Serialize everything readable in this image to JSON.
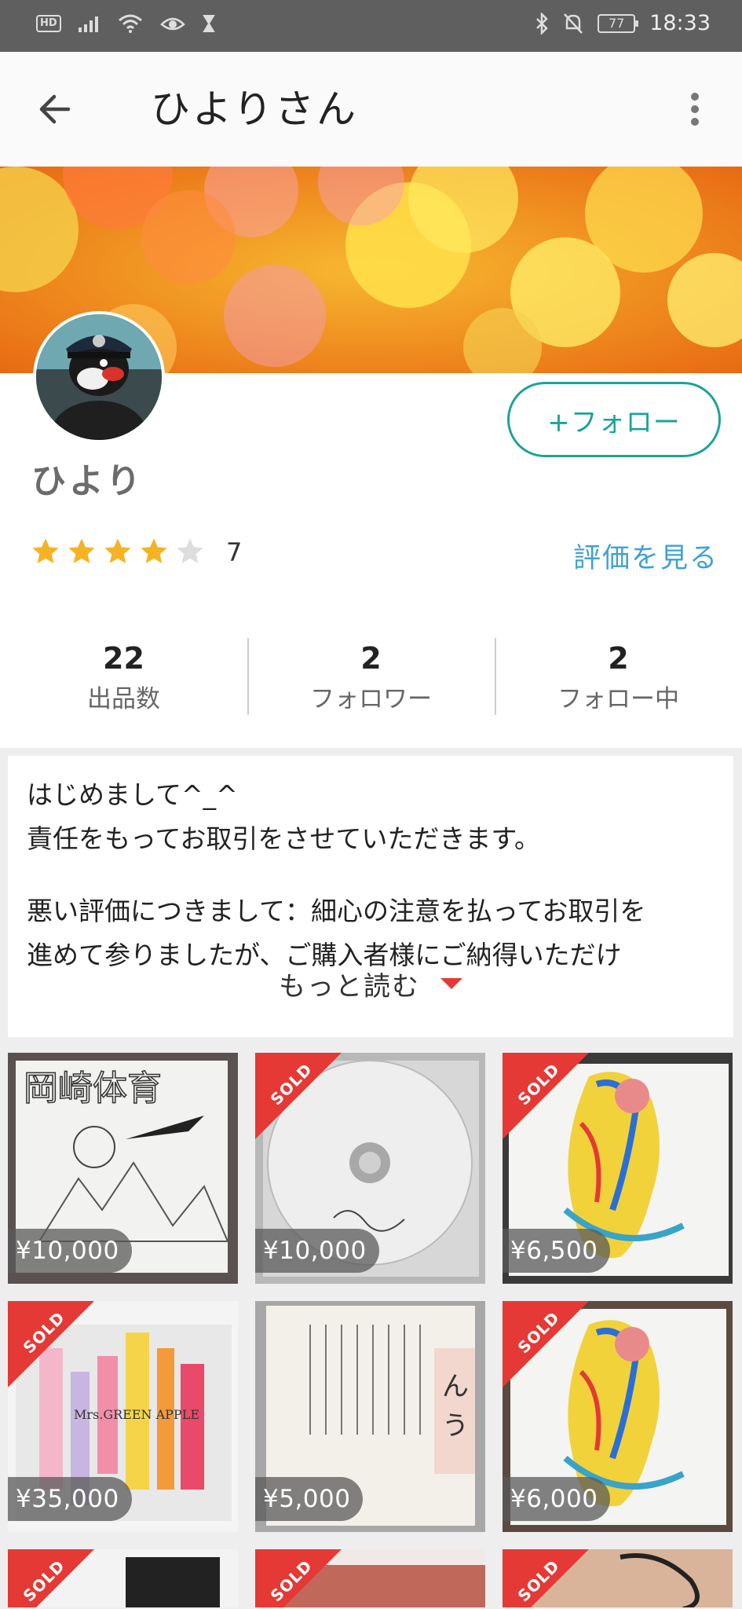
{
  "status_bar": {
    "hd": "HD",
    "battery": "77",
    "time": "18:33"
  },
  "header": {
    "title": "ひよりさん"
  },
  "profile": {
    "name": "ひより",
    "follow_label": "+フォロー",
    "rating": 4,
    "rating_count": "7",
    "reviews_link": "評価を見る"
  },
  "stats": [
    {
      "value": "22",
      "label": "出品数"
    },
    {
      "value": "2",
      "label": "フォロワー"
    },
    {
      "value": "2",
      "label": "フォロー中"
    }
  ],
  "bio": {
    "lines": [
      "はじめまして^_^",
      "責任をもってお取引をさせていただきます。",
      "悪い評価につきまして：細心の注意を払ってお取引を",
      "進めて参りましたが、ご購入者様にご納得いただけ"
    ],
    "read_more": "もっと読む"
  },
  "items": [
    {
      "price": "¥10,000",
      "sold": false
    },
    {
      "price": "¥10,000",
      "sold": true,
      "sold_label": "SOLD"
    },
    {
      "price": "¥6,500",
      "sold": true,
      "sold_label": "SOLD"
    },
    {
      "price": "¥35,000",
      "sold": true,
      "sold_label": "SOLD"
    },
    {
      "price": "¥5,000",
      "sold": false
    },
    {
      "price": "¥6,000",
      "sold": true,
      "sold_label": "SOLD"
    }
  ],
  "items_row3_sold_label": "SOLD",
  "colors": {
    "accent": "#1ba399",
    "link": "#3fa1d6",
    "sold": "#e53935",
    "star": "#f5b323"
  }
}
